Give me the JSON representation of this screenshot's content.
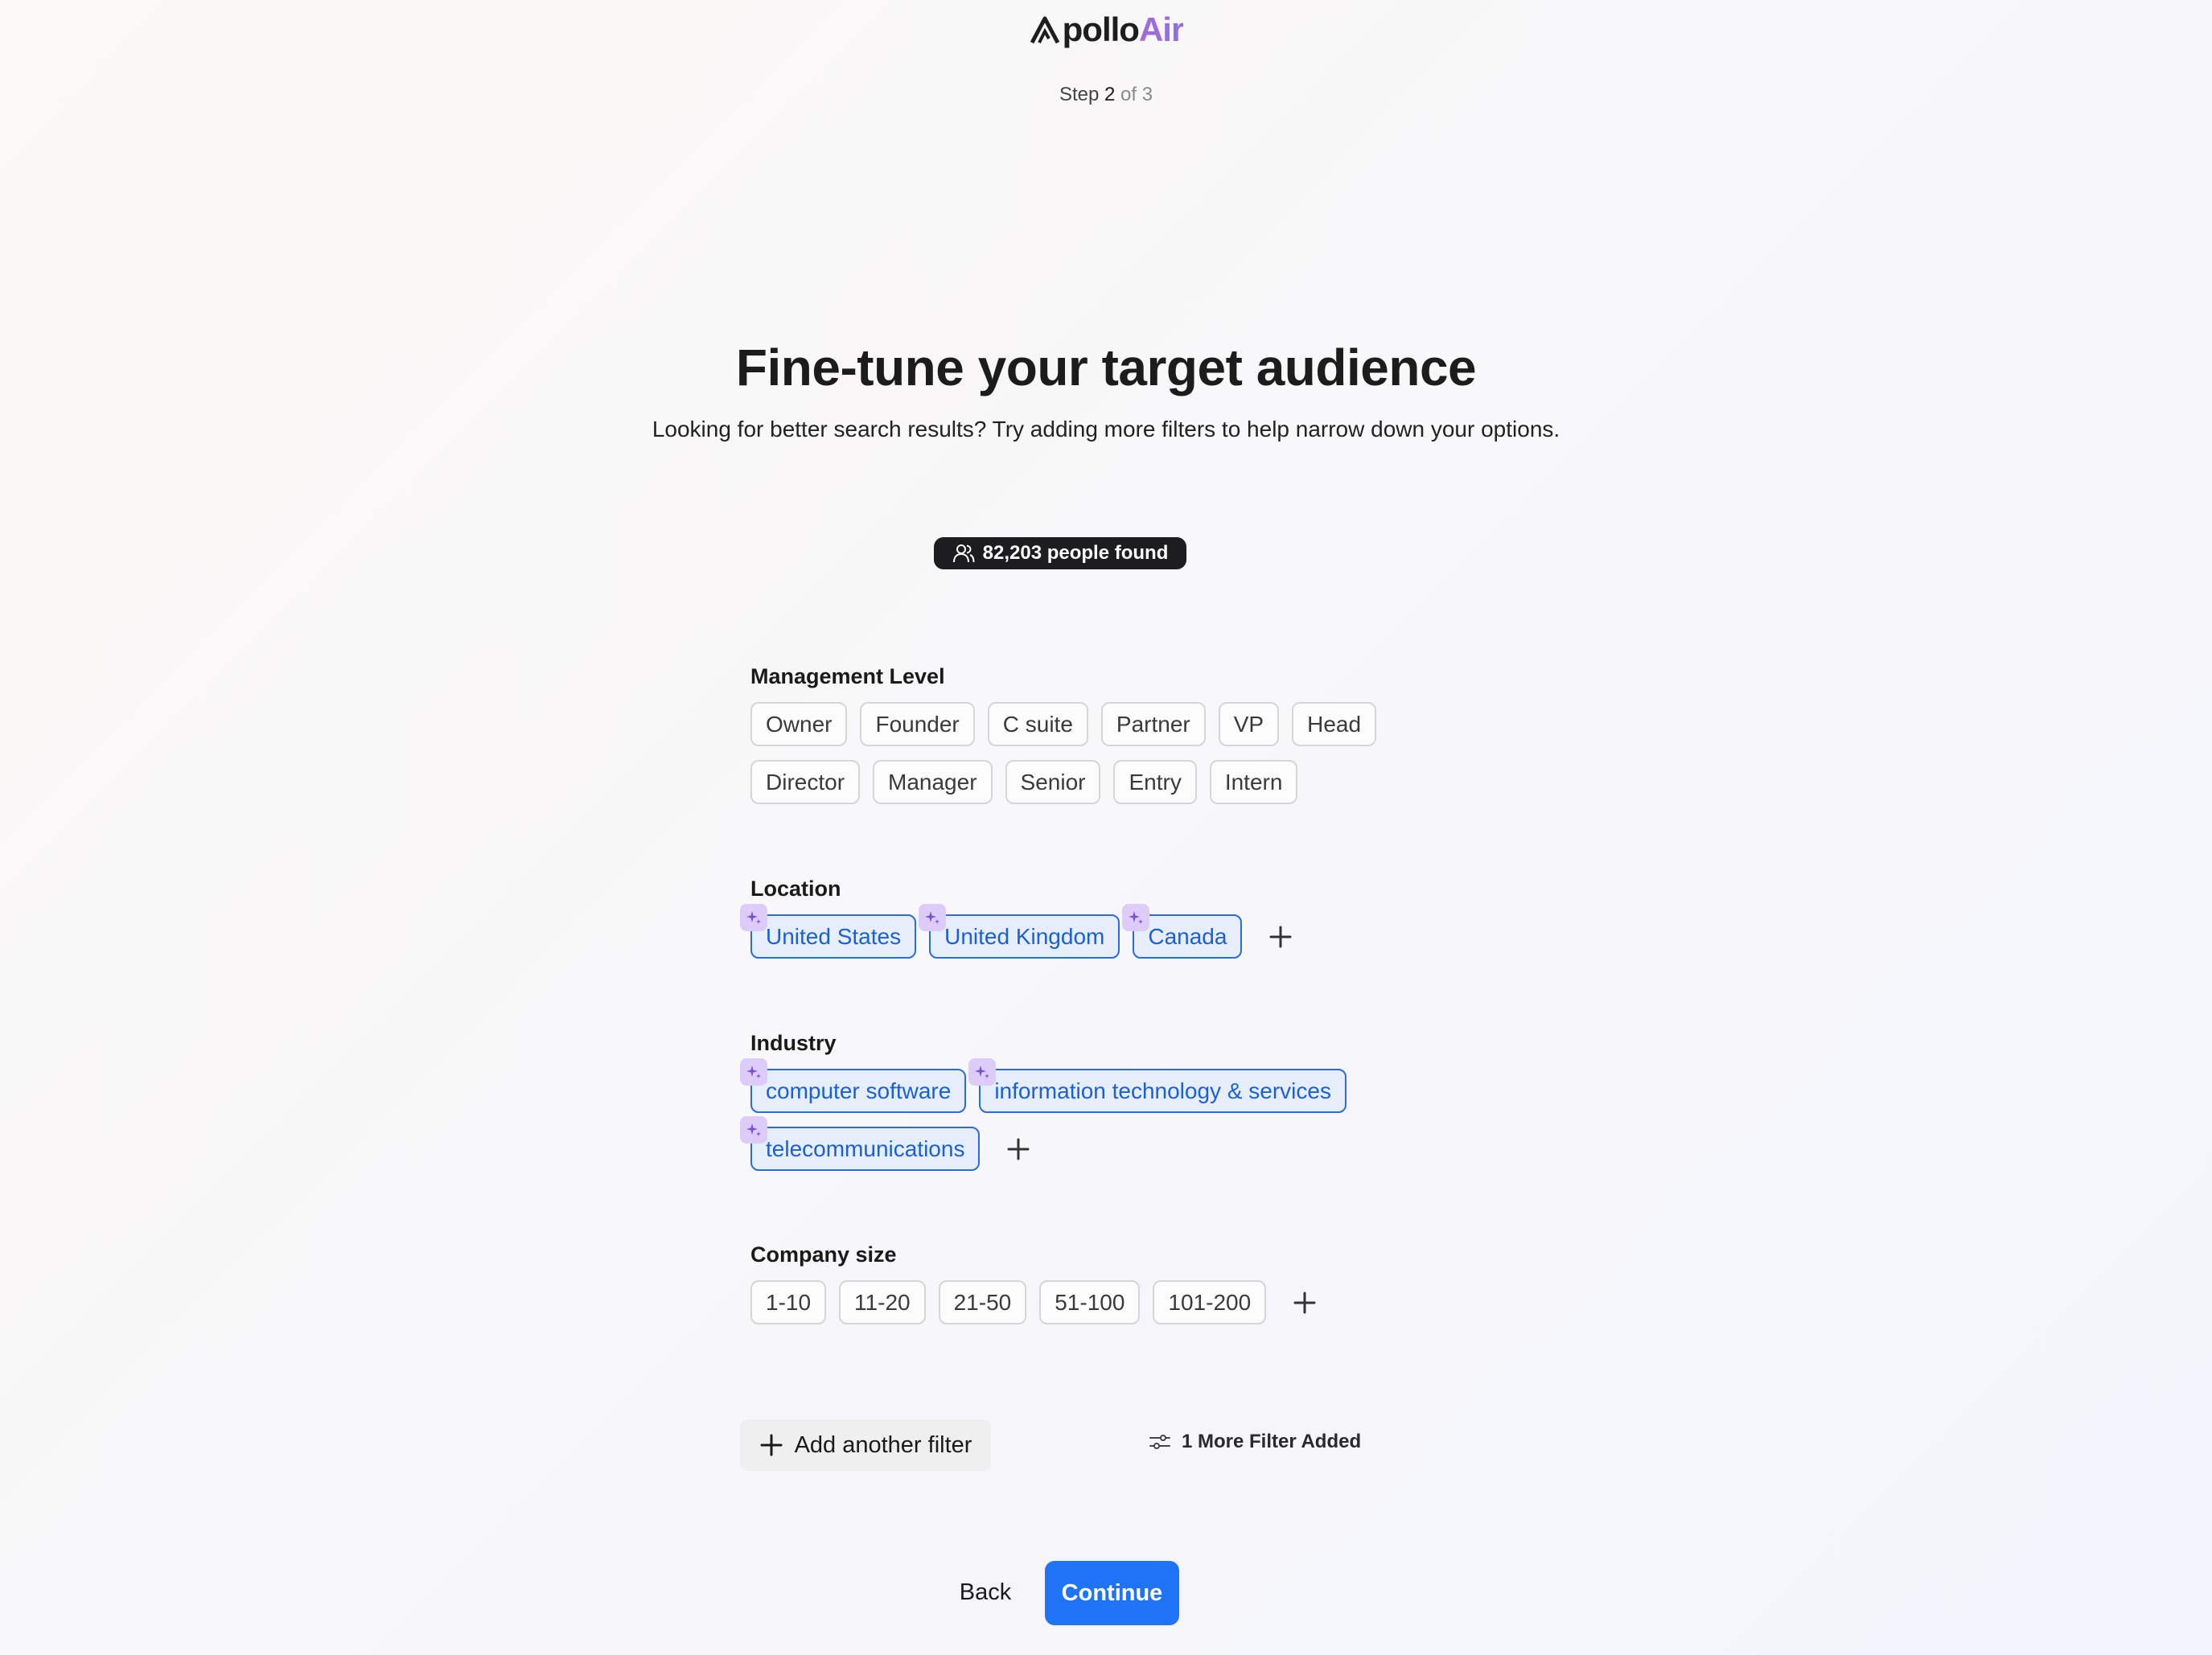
{
  "header": {
    "logo_apollo": "pollo",
    "logo_air": "Air",
    "logo_icon": "apollo-a-mark",
    "step_prefix": "Step",
    "step_current": "2",
    "step_rest": "of 3"
  },
  "title": "Fine-tune your target audience",
  "subtitle": "Looking for better search results? Try adding more filters to help narrow down your options.",
  "results": {
    "icon": "people-icon",
    "label": "82,203 people found"
  },
  "management_level": {
    "label": "Management Level",
    "options": [
      "Owner",
      "Founder",
      "C suite",
      "Partner",
      "VP",
      "Head",
      "Director",
      "Manager",
      "Senior",
      "Entry",
      "Intern"
    ]
  },
  "location": {
    "label": "Location",
    "selected": [
      "United States",
      "United Kingdom",
      "Canada"
    ]
  },
  "industry": {
    "label": "Industry",
    "selected": [
      "computer software",
      "information technology & services",
      "telecommunications"
    ]
  },
  "company_size": {
    "label": "Company size",
    "options": [
      "1-10",
      "11-20",
      "21-50",
      "51-100",
      "101-200"
    ]
  },
  "actions": {
    "add_filter": "Add another filter",
    "more_filters": "1 More Filter Added",
    "back": "Back",
    "continue": "Continue"
  },
  "colors": {
    "accent_blue": "#1f73f6",
    "selected_border": "#2a6ce0",
    "selected_bg": "#e6eefc",
    "ai_spark_bg": "#dcccf7",
    "ai_spark_icon": "#7b4fd6"
  }
}
